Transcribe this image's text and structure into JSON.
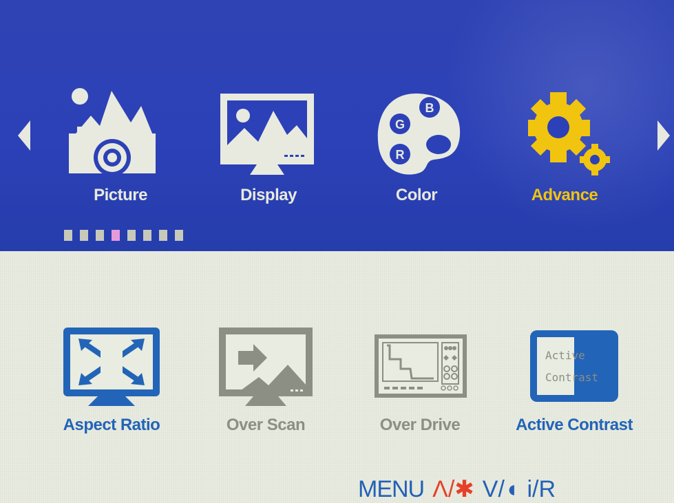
{
  "osd": {
    "tabs": [
      {
        "label": "Picture",
        "icon": "picture-icon",
        "active": false
      },
      {
        "label": "Display",
        "icon": "display-icon",
        "active": false
      },
      {
        "label": "Color",
        "icon": "color-palette-icon",
        "active": false
      },
      {
        "label": "Advance",
        "icon": "gear-icon",
        "active": true
      }
    ],
    "palette_letters": [
      "B",
      "G",
      "R"
    ],
    "page_indicator": {
      "total": 8,
      "current_index": 3
    },
    "items": [
      {
        "label": "Aspect Ratio",
        "icon": "aspect-ratio-icon",
        "enabled": true
      },
      {
        "label": "Over Scan",
        "icon": "over-scan-icon",
        "enabled": false
      },
      {
        "label": "Over Drive",
        "icon": "over-drive-icon",
        "enabled": false
      },
      {
        "label": "Active Contrast",
        "icon": "active-contrast-icon",
        "enabled": true,
        "icon_text_line1": "Active",
        "icon_text_line2": "Contrast"
      }
    ],
    "footer": {
      "menu": "MENU",
      "up": "Λ/✱",
      "down": "V/◖",
      "info": "i/R"
    },
    "colors": {
      "blue_band": "#2c41b7",
      "highlight_yellow": "#f1c410",
      "icon_light": "#e8eadf",
      "item_blue": "#2264b8",
      "item_gray": "#8c8f84",
      "indicator_active": "#e69ad9",
      "indicator_inactive": "#c7cabb"
    }
  }
}
